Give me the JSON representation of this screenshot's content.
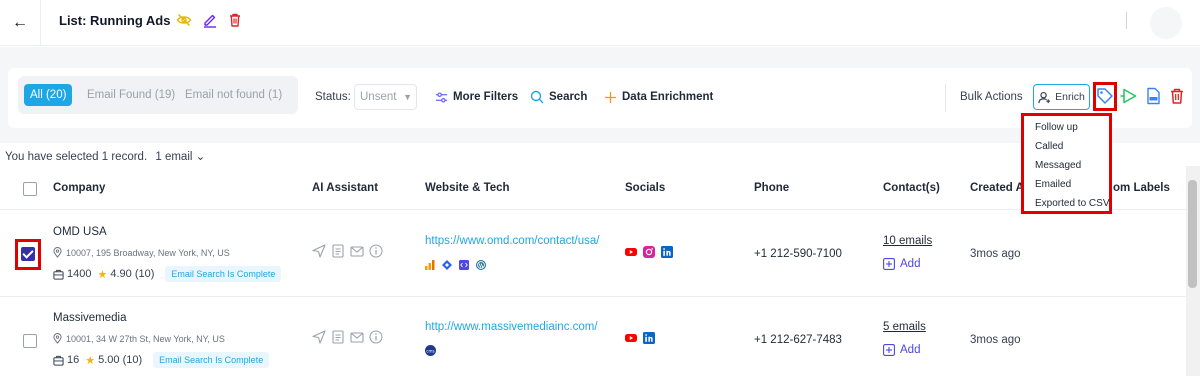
{
  "header": {
    "title": "List: Running Ads",
    "back_glyph": "←"
  },
  "filters": {
    "tabs": [
      {
        "label": "All (20)",
        "active": true
      },
      {
        "label": "Email Found (19)",
        "active": false
      },
      {
        "label": "Email not found (1)",
        "active": false
      }
    ],
    "status_label": "Status:",
    "status_value": "Unsent",
    "more_filters": "More Filters",
    "search": "Search",
    "data_enrichment": "Data Enrichment",
    "bulk_actions": "Bulk Actions",
    "enrich": "Enrich"
  },
  "tag_menu": {
    "items": [
      "Follow up",
      "Called",
      "Messaged",
      "Emailed",
      "Exported to CSV"
    ]
  },
  "selection": {
    "summary": "You have selected 1 record.",
    "email_count": "1 email"
  },
  "table": {
    "headers": {
      "company": "Company",
      "ai": "AI Assistant",
      "website": "Website & Tech",
      "socials": "Socials",
      "phone": "Phone",
      "contacts": "Contact(s)",
      "created": "Created A",
      "labels": "om Labels"
    },
    "rows": [
      {
        "checked": true,
        "company": "OMD USA",
        "address": "10007, 195 Broadway, New York, NY, US",
        "employees": "1400",
        "rating": "4.90 (10)",
        "status_pill": "Email Search Is Complete",
        "website": "https://www.omd.com/contact/usa/",
        "phone": "+1 212-590-7100",
        "emails": "10 emails",
        "add_label": "Add",
        "created": "3mos ago"
      },
      {
        "checked": false,
        "company": "Massivemedia",
        "address": "10001, 34 W 27th St, New York, NY, US",
        "employees": "16",
        "rating": "5.00 (10)",
        "status_pill": "Email Search Is Complete",
        "website": "http://www.massivemediainc.com/",
        "phone": "+1 212-627-7483",
        "emails": "5 emails",
        "add_label": "Add",
        "created": "3mos ago"
      }
    ]
  },
  "colors": {
    "accent": "#1ea7e4",
    "highlight": "#e00000",
    "checkbox": "#3730a3"
  }
}
